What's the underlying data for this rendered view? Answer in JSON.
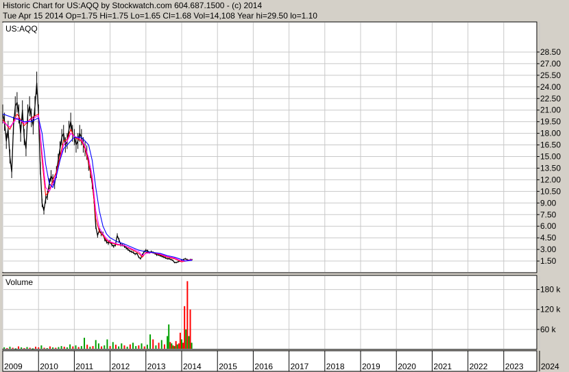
{
  "header": {
    "line1": "Historic Chart for US:AQQ by Stockwatch.com 604.687.1500 - (c) 2014",
    "line2": "Tue Apr 15 2014  Op=1.75  Hi=1.75  Lo=1.65  Cl=1.68  Vol=14,108  Year hi=29.50  lo=1.10"
  },
  "colors": {
    "background": "#d4d0c8",
    "panel": "#ffffff",
    "grid": "#c8c8c8",
    "price_bar": "#000000",
    "ma_short": "#ff0000",
    "ma_mid": "#ff00ff",
    "ma_long": "#0000ff",
    "volume_up": "#00a000",
    "volume_down": "#ff0000"
  },
  "chart_data": [
    {
      "type": "line",
      "title": "US:AQQ",
      "ylim": [
        0,
        30
      ],
      "y_ticks": [
        "1.50",
        "3.00",
        "4.50",
        "6.00",
        "7.50",
        "9.00",
        "10.50",
        "12.00",
        "13.50",
        "15.00",
        "16.50",
        "18.00",
        "19.50",
        "21.00",
        "22.50",
        "24.00",
        "25.50",
        "27.00",
        "28.50"
      ],
      "x_ticks": [
        "2009",
        "2010",
        "2011",
        "2012",
        "2013",
        "2014",
        "2015",
        "2016",
        "2017",
        "2018",
        "2019",
        "2020",
        "2021",
        "2022",
        "2023",
        "2024"
      ],
      "x_range": [
        2009.0,
        2024.4
      ],
      "series": [
        {
          "role": "price",
          "x": [
            2009.0,
            2009.05,
            2009.1,
            2009.15,
            2009.2,
            2009.25,
            2009.3,
            2009.35,
            2009.4,
            2009.45,
            2009.5,
            2009.55,
            2009.6,
            2009.65,
            2009.7,
            2009.75,
            2009.8,
            2009.85,
            2009.9,
            2009.95,
            2010.0,
            2010.05,
            2010.1,
            2010.15,
            2010.2,
            2010.25,
            2010.3,
            2010.35,
            2010.4,
            2010.45,
            2010.5,
            2010.55,
            2010.6,
            2010.65,
            2010.7,
            2010.75,
            2010.8,
            2010.85,
            2010.9,
            2010.95,
            2011.0,
            2011.05,
            2011.1,
            2011.15,
            2011.2,
            2011.25,
            2011.3,
            2011.35,
            2011.4,
            2011.45,
            2011.5,
            2011.55,
            2011.6,
            2011.65,
            2011.7,
            2011.75,
            2011.8,
            2011.85,
            2011.9,
            2011.95,
            2012.0,
            2012.05,
            2012.1,
            2012.15,
            2012.2,
            2012.25,
            2012.3,
            2012.35,
            2012.4,
            2012.45,
            2012.5,
            2012.55,
            2012.6,
            2012.65,
            2012.7,
            2012.75,
            2012.8,
            2012.85,
            2012.9,
            2012.95,
            2013.0,
            2013.05,
            2013.1,
            2013.15,
            2013.2,
            2013.25,
            2013.3,
            2013.35,
            2013.4,
            2013.45,
            2013.5,
            2013.55,
            2013.6,
            2013.65,
            2013.7,
            2013.75,
            2013.8,
            2013.85,
            2013.9,
            2013.95,
            2014.0,
            2014.05,
            2014.1,
            2014.15,
            2014.2,
            2014.25,
            2014.29
          ],
          "values": [
            20.5,
            19.5,
            17.0,
            18.5,
            15.0,
            13.0,
            19.0,
            21.5,
            22.0,
            20.5,
            18.0,
            21.0,
            17.5,
            16.0,
            20.5,
            21.5,
            20.0,
            19.0,
            21.5,
            24.5,
            20.5,
            13.5,
            9.0,
            8.0,
            9.5,
            10.0,
            11.5,
            12.5,
            12.0,
            11.5,
            13.0,
            14.5,
            16.0,
            17.5,
            18.0,
            16.5,
            17.0,
            18.5,
            19.5,
            18.0,
            17.5,
            16.5,
            17.0,
            18.0,
            17.5,
            16.5,
            16.0,
            15.5,
            14.0,
            13.0,
            11.5,
            9.5,
            6.0,
            4.8,
            5.5,
            5.0,
            5.0,
            4.3,
            4.0,
            3.8,
            4.0,
            3.6,
            3.4,
            3.6,
            4.8,
            4.2,
            3.6,
            3.6,
            3.4,
            3.2,
            3.0,
            2.8,
            2.7,
            2.6,
            2.4,
            2.5,
            2.0,
            1.8,
            2.3,
            2.7,
            2.9,
            2.8,
            2.6,
            2.7,
            2.6,
            2.5,
            2.3,
            2.3,
            2.2,
            2.1,
            2.0,
            1.9,
            1.8,
            1.8,
            1.7,
            1.6,
            1.3,
            1.3,
            1.4,
            1.5,
            1.6,
            1.7,
            1.8,
            1.7,
            1.6,
            1.7,
            1.68
          ]
        },
        {
          "role": "moving-average-short",
          "x": [
            2009.0,
            2009.2,
            2009.4,
            2009.6,
            2009.8,
            2010.0,
            2010.1,
            2010.2,
            2010.3,
            2010.4,
            2010.5,
            2010.6,
            2010.7,
            2010.8,
            2010.9,
            2011.0,
            2011.2,
            2011.3,
            2011.4,
            2011.5,
            2011.6,
            2011.7,
            2011.8,
            2011.9,
            2012.0,
            2012.2,
            2012.4,
            2012.6,
            2012.8,
            2012.9,
            2013.0,
            2013.2,
            2013.4,
            2013.6,
            2013.8,
            2014.0,
            2014.2,
            2014.29
          ],
          "values": [
            19.8,
            18.5,
            20.5,
            19.0,
            20.0,
            20.5,
            14.5,
            10.0,
            10.5,
            12.0,
            13.0,
            15.0,
            17.0,
            17.2,
            18.5,
            17.5,
            17.0,
            16.0,
            14.2,
            11.8,
            7.0,
            5.3,
            4.8,
            4.2,
            3.9,
            3.6,
            3.5,
            3.0,
            2.5,
            2.0,
            2.6,
            2.6,
            2.3,
            2.0,
            1.8,
            1.4,
            1.6,
            1.7
          ]
        },
        {
          "role": "moving-average-mid",
          "x": [
            2009.0,
            2009.2,
            2009.4,
            2009.6,
            2009.8,
            2010.0,
            2010.1,
            2010.2,
            2010.3,
            2010.4,
            2010.5,
            2010.6,
            2010.7,
            2010.8,
            2010.9,
            2011.0,
            2011.2,
            2011.3,
            2011.4,
            2011.5,
            2011.6,
            2011.7,
            2011.8,
            2011.9,
            2012.0,
            2012.2,
            2012.4,
            2012.6,
            2012.8,
            2012.9,
            2013.0,
            2013.2,
            2013.4,
            2013.6,
            2013.8,
            2014.0,
            2014.2,
            2014.29
          ],
          "values": [
            19.5,
            18.8,
            20.0,
            19.3,
            19.8,
            20.3,
            15.5,
            11.0,
            10.5,
            11.5,
            12.7,
            14.5,
            16.5,
            17.0,
            18.0,
            17.6,
            17.2,
            16.3,
            14.8,
            12.5,
            8.0,
            5.8,
            5.0,
            4.4,
            4.0,
            3.7,
            3.5,
            3.1,
            2.7,
            2.2,
            2.5,
            2.6,
            2.4,
            2.1,
            1.9,
            1.5,
            1.6,
            1.7
          ]
        },
        {
          "role": "moving-average-long",
          "x": [
            2009.0,
            2009.3,
            2009.6,
            2009.8,
            2010.0,
            2010.1,
            2010.2,
            2010.3,
            2010.4,
            2010.5,
            2010.6,
            2010.7,
            2010.8,
            2010.9,
            2011.0,
            2011.2,
            2011.4,
            2011.5,
            2011.6,
            2011.7,
            2011.8,
            2011.9,
            2012.0,
            2012.2,
            2012.4,
            2012.6,
            2012.8,
            2013.0,
            2013.2,
            2013.4,
            2013.6,
            2013.8,
            2014.0,
            2014.1,
            2014.29
          ],
          "values": [
            20.5,
            20.0,
            19.5,
            19.5,
            20.0,
            18.0,
            14.0,
            11.5,
            11.0,
            12.5,
            14.5,
            16.0,
            16.5,
            17.0,
            17.5,
            17.5,
            16.5,
            14.5,
            11.0,
            8.0,
            6.0,
            5.0,
            4.5,
            4.0,
            3.7,
            3.3,
            2.9,
            2.7,
            2.6,
            2.5,
            2.2,
            2.0,
            1.7,
            1.5,
            1.6
          ]
        }
      ]
    },
    {
      "type": "bar",
      "title": "Volume",
      "ylim": [
        0,
        210000
      ],
      "y_ticks": [
        "60 k",
        "120 k",
        "180 k"
      ],
      "x": [
        2009.04,
        2009.12,
        2009.2,
        2009.28,
        2009.36,
        2009.44,
        2009.52,
        2009.6,
        2009.68,
        2009.76,
        2009.84,
        2009.92,
        2010.0,
        2010.08,
        2010.16,
        2010.24,
        2010.32,
        2010.4,
        2010.48,
        2010.56,
        2010.64,
        2010.72,
        2010.8,
        2010.88,
        2010.96,
        2011.04,
        2011.12,
        2011.2,
        2011.28,
        2011.36,
        2011.44,
        2011.52,
        2011.6,
        2011.68,
        2011.76,
        2011.84,
        2011.92,
        2012.0,
        2012.08,
        2012.16,
        2012.24,
        2012.32,
        2012.4,
        2012.48,
        2012.56,
        2012.64,
        2012.72,
        2012.8,
        2012.88,
        2012.96,
        2013.04,
        2013.12,
        2013.2,
        2013.28,
        2013.36,
        2013.44,
        2013.52,
        2013.6,
        2013.64,
        2013.68,
        2013.72,
        2013.76,
        2013.8,
        2013.84,
        2013.88,
        2013.92,
        2013.96,
        2014.0,
        2014.04,
        2014.08,
        2014.12,
        2014.16,
        2014.2,
        2014.24,
        2014.28
      ],
      "values": [
        6000,
        4000,
        8000,
        5000,
        3000,
        9000,
        6000,
        4000,
        7000,
        5000,
        3000,
        8000,
        6000,
        12000,
        5000,
        4000,
        9000,
        6000,
        5000,
        7000,
        10000,
        8000,
        6000,
        15000,
        9000,
        12000,
        7000,
        10000,
        35000,
        14000,
        8000,
        10000,
        28000,
        18000,
        9000,
        12000,
        30000,
        10000,
        22000,
        14000,
        9000,
        18000,
        12000,
        8000,
        15000,
        20000,
        10000,
        12000,
        18000,
        9000,
        14000,
        45000,
        30000,
        12000,
        20000,
        28000,
        15000,
        40000,
        75000,
        22000,
        18000,
        12000,
        10000,
        25000,
        15000,
        18000,
        50000,
        30000,
        20000,
        130000,
        60000,
        205000,
        40000,
        120000,
        20000
      ],
      "directions": [
        "up",
        "down",
        "up",
        "down",
        "up",
        "down",
        "up",
        "down",
        "up",
        "down",
        "up",
        "down",
        "down",
        "up",
        "down",
        "up",
        "down",
        "up",
        "down",
        "up",
        "up",
        "down",
        "up",
        "up",
        "down",
        "up",
        "down",
        "up",
        "up",
        "down",
        "up",
        "down",
        "up",
        "up",
        "down",
        "up",
        "up",
        "down",
        "up",
        "down",
        "up",
        "up",
        "down",
        "up",
        "down",
        "up",
        "up",
        "down",
        "up",
        "down",
        "up",
        "up",
        "down",
        "up",
        "down",
        "up",
        "down",
        "up",
        "up",
        "down",
        "up",
        "down",
        "up",
        "down",
        "up",
        "down",
        "down",
        "up",
        "down",
        "down",
        "up",
        "down",
        "up",
        "down",
        "up"
      ]
    }
  ]
}
